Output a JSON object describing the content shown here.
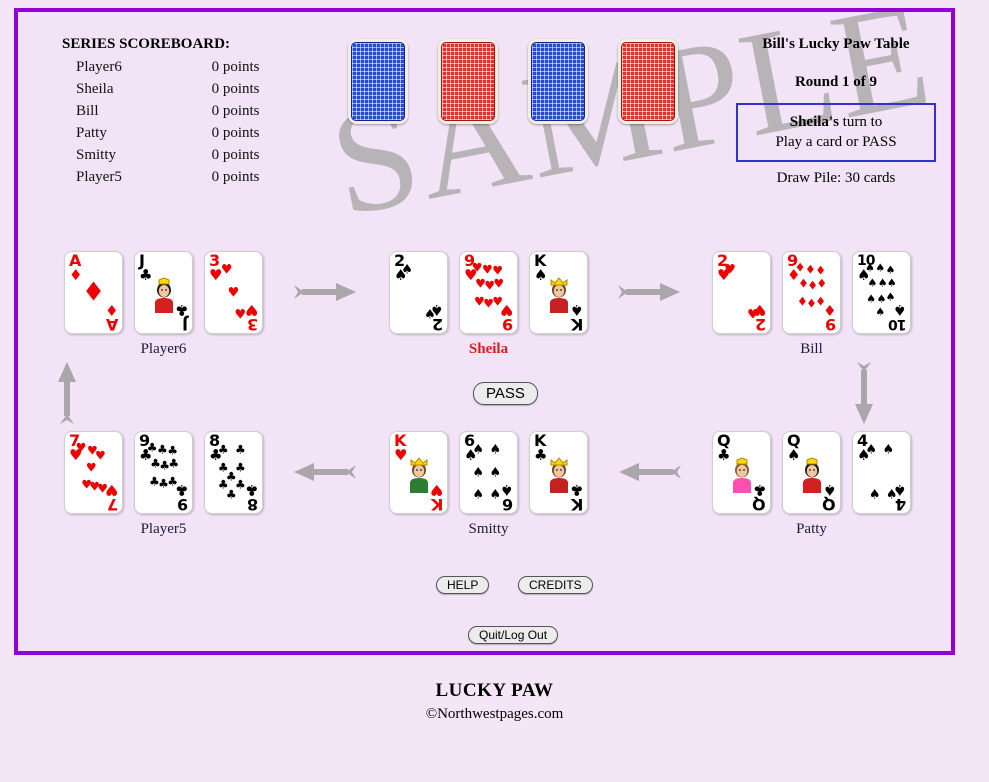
{
  "page": {
    "background_color": "#f5e6f7",
    "frame_border_color": "#9400d3",
    "frame_background": "#f2e3f7",
    "watermark": "SAMPLE"
  },
  "scoreboard": {
    "title": "SERIES SCOREBOARD:",
    "rows": [
      {
        "name": "Player6",
        "score": "0 points"
      },
      {
        "name": "Sheila",
        "score": "0 points"
      },
      {
        "name": "Bill",
        "score": "0 points"
      },
      {
        "name": "Patty",
        "score": "0 points"
      },
      {
        "name": "Smitty",
        "score": "0 points"
      },
      {
        "name": "Player5",
        "score": "0 points"
      }
    ]
  },
  "deck_row": {
    "cards": [
      {
        "color": "blue"
      },
      {
        "color": "red"
      },
      {
        "color": "blue"
      },
      {
        "color": "red"
      }
    ]
  },
  "info_panel": {
    "table_title": "Bill's Lucky Paw Table",
    "round": "Round 1 of 9",
    "turn_name": "Sheila's",
    "turn_suffix": " turn to",
    "turn_action": "Play a card or PASS",
    "draw_pile": "Draw Pile: 30 cards",
    "turn_box_border": "#3333cc"
  },
  "hands": [
    {
      "player": "Player6",
      "active": false,
      "cards": [
        {
          "rank": "A",
          "suit": "♦",
          "color": "red",
          "type": "pip",
          "label": "Ace of Diamonds"
        },
        {
          "rank": "J",
          "suit": "♣",
          "color": "black",
          "type": "court",
          "label": "Jack of Clubs"
        },
        {
          "rank": "3",
          "suit": "♥",
          "color": "red",
          "type": "pip",
          "label": "Three of Hearts"
        }
      ]
    },
    {
      "player": "Sheila",
      "active": true,
      "cards": [
        {
          "rank": "2",
          "suit": "♠",
          "color": "black",
          "type": "pip",
          "label": "Two of Spades"
        },
        {
          "rank": "9",
          "suit": "♥",
          "color": "red",
          "type": "pip",
          "label": "Nine of Hearts"
        },
        {
          "rank": "K",
          "suit": "♠",
          "color": "black",
          "type": "court",
          "label": "King of Spades"
        }
      ]
    },
    {
      "player": "Bill",
      "active": false,
      "cards": [
        {
          "rank": "2",
          "suit": "♥",
          "color": "red",
          "type": "pip",
          "label": "Two of Hearts"
        },
        {
          "rank": "9",
          "suit": "♦",
          "color": "red",
          "type": "pip",
          "label": "Nine of Diamonds"
        },
        {
          "rank": "10",
          "suit": "♠",
          "color": "black",
          "type": "pip",
          "label": "Ten of Spades"
        }
      ]
    },
    {
      "player": "Player5",
      "active": false,
      "cards": [
        {
          "rank": "7",
          "suit": "♥",
          "color": "red",
          "type": "pip",
          "label": "Seven of Hearts"
        },
        {
          "rank": "9",
          "suit": "♣",
          "color": "black",
          "type": "pip",
          "label": "Nine of Clubs"
        },
        {
          "rank": "8",
          "suit": "♣",
          "color": "black",
          "type": "pip",
          "label": "Eight of Clubs"
        }
      ]
    },
    {
      "player": "Smitty",
      "active": false,
      "cards": [
        {
          "rank": "K",
          "suit": "♥",
          "color": "red",
          "type": "court",
          "label": "King of Hearts"
        },
        {
          "rank": "6",
          "suit": "♠",
          "color": "black",
          "type": "pip",
          "label": "Six of Spades"
        },
        {
          "rank": "K",
          "suit": "♣",
          "color": "black",
          "type": "court",
          "label": "King of Clubs"
        }
      ]
    },
    {
      "player": "Patty",
      "active": false,
      "cards": [
        {
          "rank": "Q",
          "suit": "♣",
          "color": "black",
          "type": "court",
          "label": "Queen of Clubs"
        },
        {
          "rank": "Q",
          "suit": "♠",
          "color": "black",
          "type": "court",
          "label": "Queen of Spades"
        },
        {
          "rank": "4",
          "suit": "♠",
          "color": "black",
          "type": "pip",
          "label": "Four of Spades"
        }
      ]
    }
  ],
  "arrows": {
    "color": "#aaa6aa",
    "directions": [
      "right",
      "right",
      "down",
      "left",
      "left",
      "up"
    ]
  },
  "buttons": {
    "pass": "PASS",
    "help": "HELP",
    "credits": "CREDITS",
    "quit": "Quit/Log Out"
  },
  "footer": {
    "title": "LUCKY PAW",
    "copyright": "©Northwestpages.com"
  }
}
